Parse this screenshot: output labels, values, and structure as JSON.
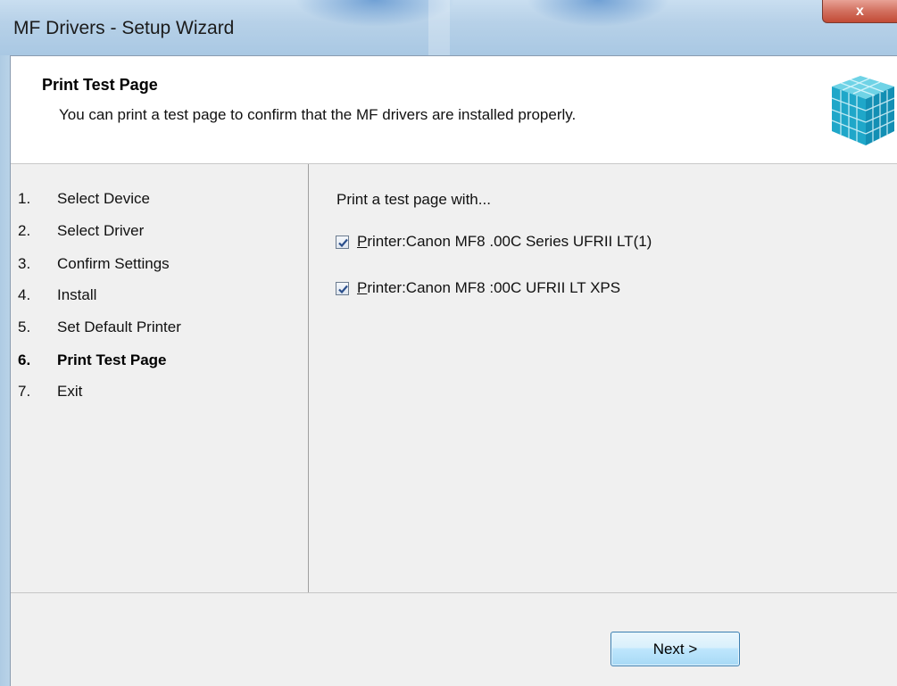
{
  "window": {
    "title": "MF Drivers - Setup Wizard",
    "close_label": "x"
  },
  "header": {
    "title": "Print Test Page",
    "description": "You can print a test page to confirm that the MF drivers are installed properly.",
    "icon": "cube-icon"
  },
  "steps": [
    {
      "num": "1.",
      "label": "Select Device",
      "active": false
    },
    {
      "num": "2.",
      "label": "Select Driver",
      "active": false
    },
    {
      "num": "3.",
      "label": "Confirm Settings",
      "active": false
    },
    {
      "num": "4.",
      "label": "Install",
      "active": false
    },
    {
      "num": "5.",
      "label": "Set Default Printer",
      "active": false
    },
    {
      "num": "6.",
      "label": "Print Test Page",
      "active": true
    },
    {
      "num": "7.",
      "label": "Exit",
      "active": false
    }
  ],
  "content": {
    "prompt": "Print a test page with...",
    "printers": [
      {
        "mnemonic": "P",
        "label": "rinter:Canon MF8 .00C Series UFRII LT(1)",
        "checked": true
      },
      {
        "mnemonic": "P",
        "label": "rinter:Canon MF8 :00C UFRII LT XPS",
        "checked": true
      }
    ]
  },
  "footer": {
    "next_label": "Next >"
  },
  "colors": {
    "accent": "#3c7fb1",
    "close_red": "#c24a35"
  }
}
